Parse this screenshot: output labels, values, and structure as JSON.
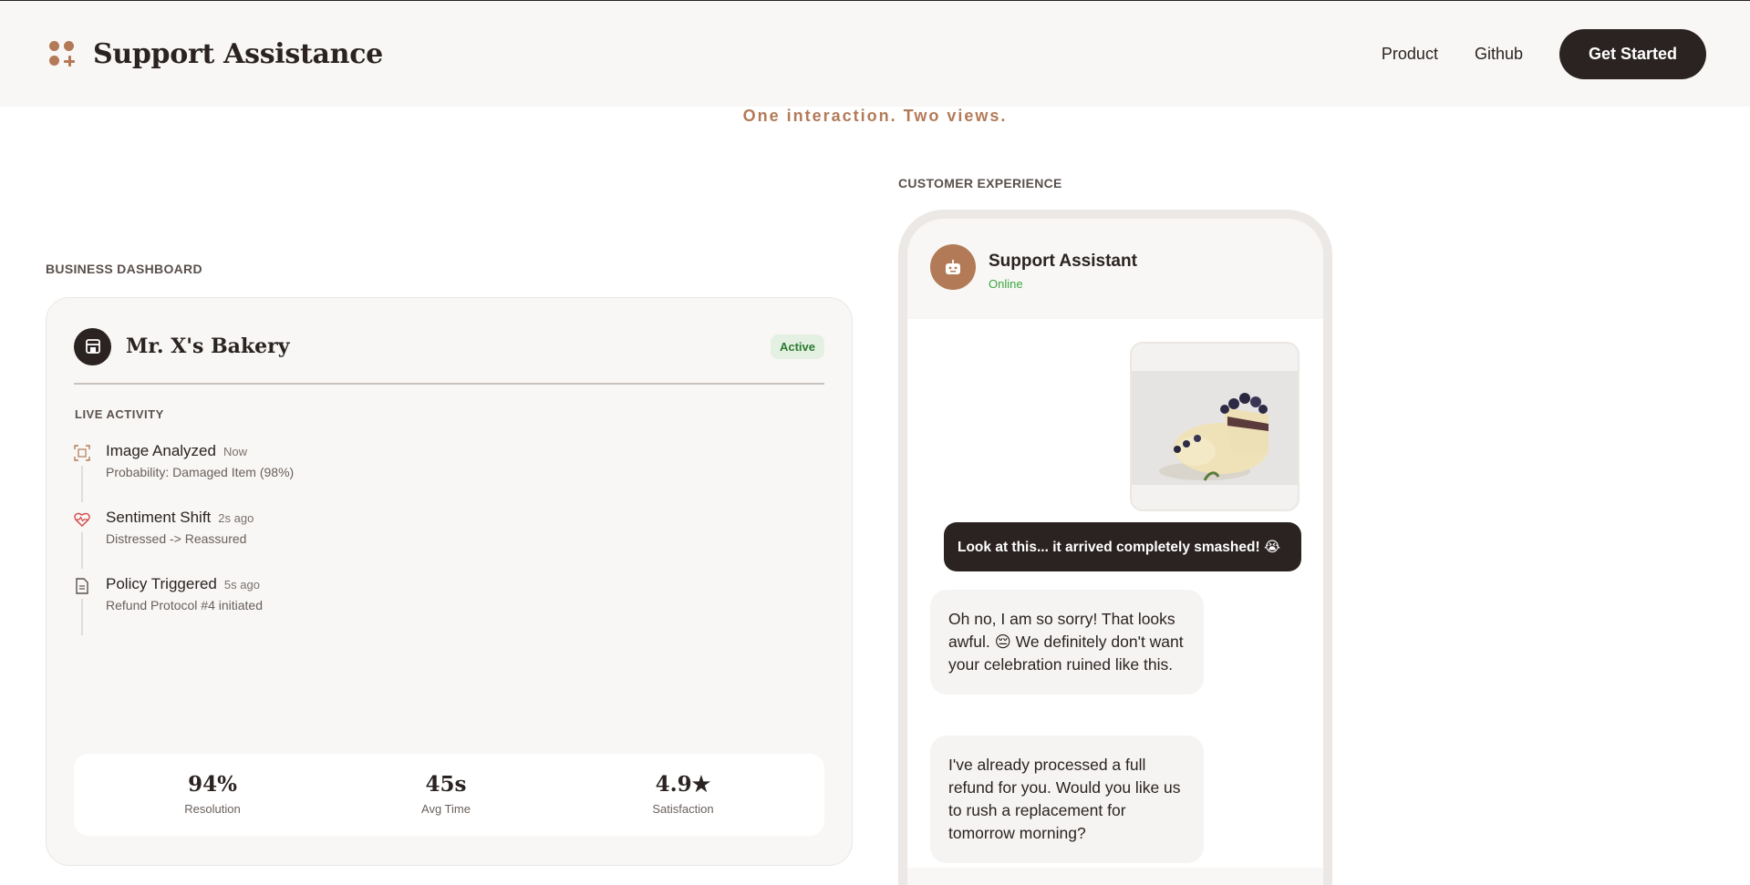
{
  "header": {
    "title": "Support Assistance",
    "nav": {
      "product": "Product",
      "github": "Github"
    },
    "cta": "Get Started"
  },
  "tagline": "One interaction. Two views.",
  "dashboard": {
    "section_label": "BUSINESS DASHBOARD",
    "store_name": "Mr. X's Bakery",
    "status": "Active",
    "live_label": "LIVE ACTIVITY",
    "activity": [
      {
        "title": "Image Analyzed",
        "time": "Now",
        "detail": "Probability: Damaged Item (98%)",
        "icon": "scan-icon"
      },
      {
        "title": "Sentiment Shift",
        "time": "2s ago",
        "detail": "Distressed -> Reassured",
        "icon": "heart-pulse-icon"
      },
      {
        "title": "Policy Triggered",
        "time": "5s ago",
        "detail": "Refund Protocol #4 initiated",
        "icon": "document-icon"
      }
    ],
    "stats": [
      {
        "value": "94%",
        "label": "Resolution"
      },
      {
        "value": "45s",
        "label": "Avg Time"
      },
      {
        "value": "4.9★",
        "label": "Satisfaction"
      }
    ]
  },
  "customer": {
    "section_label": "CUSTOMER EXPERIENCE",
    "assistant_name": "Support Assistant",
    "assistant_status": "Online",
    "user_message": "Look at this... it arrived completely smashed! 😭",
    "bot_messages": [
      "Oh no, I am so sorry! That looks awful. 😔 We definitely don't want your celebration ruined like this.",
      "I've already processed a full refund for you. Would you like us to rush a replacement for tomorrow morning?"
    ]
  },
  "colors": {
    "accent": "#b27a57",
    "dark": "#2a2321",
    "online": "#3aa63e",
    "badge_bg": "#e4f1e2"
  }
}
